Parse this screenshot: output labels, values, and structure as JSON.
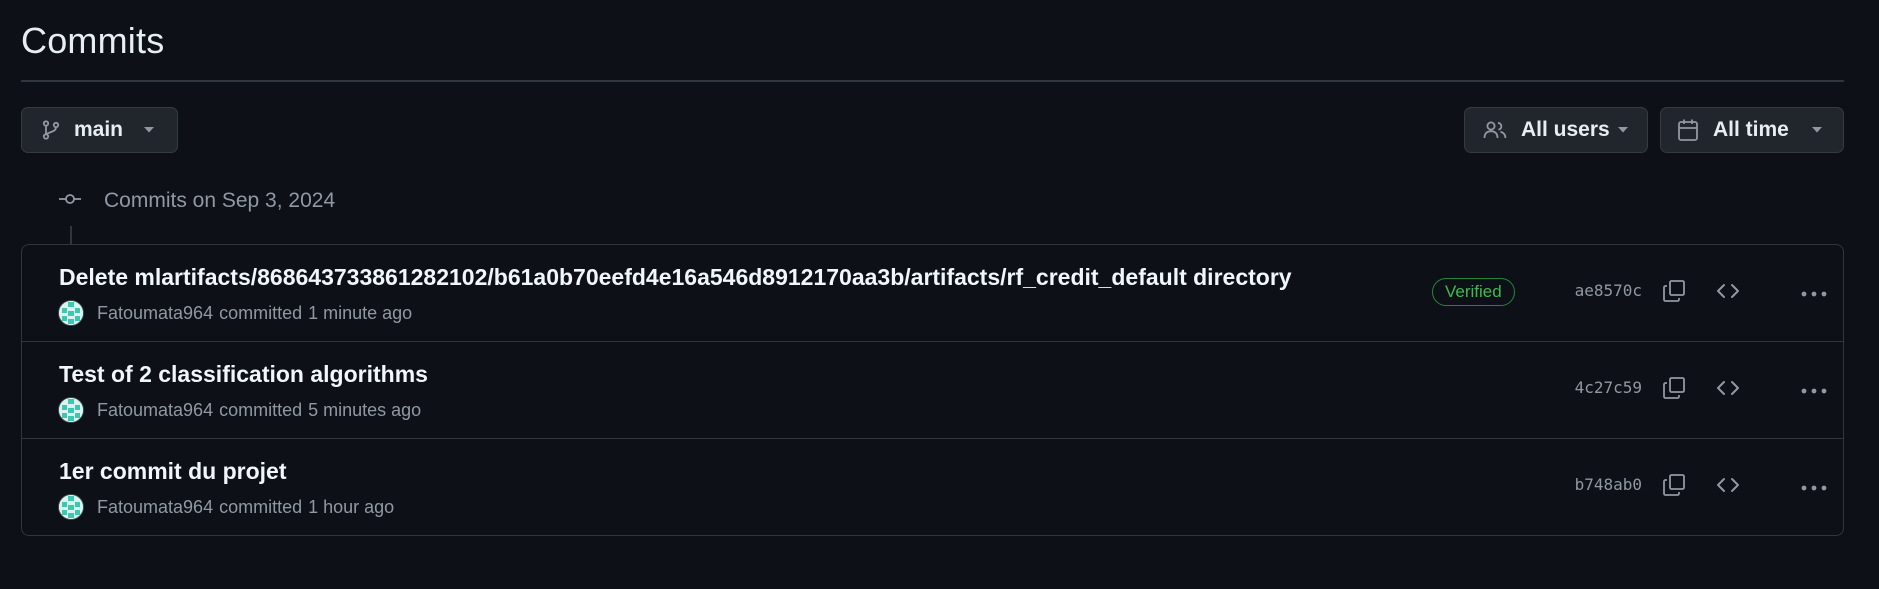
{
  "header": {
    "title": "Commits"
  },
  "filters": {
    "branch": {
      "label": "main",
      "icon": "git-branch-icon"
    },
    "users": {
      "label": "All users",
      "icon": "people-icon"
    },
    "time": {
      "label": "All time",
      "icon": "calendar-icon"
    }
  },
  "timeline": {
    "heading": "Commits on Sep 3, 2024",
    "icon": "git-commit-icon"
  },
  "commits": [
    {
      "message": "Delete mlartifacts/868643733861282102/b61a0b70eefd4e16a546d8912170aa3b/artifacts/rf_credit_default directory",
      "author": "Fatoumata964",
      "action": "committed",
      "time": "1 minute ago",
      "badge": "Verified",
      "sha": "ae8570c"
    },
    {
      "message": "Test of 2 classification algorithms",
      "author": "Fatoumata964",
      "action": "committed",
      "time": "5 minutes ago",
      "badge": "",
      "sha": "4c27c59"
    },
    {
      "message": "1er commit du projet",
      "author": "Fatoumata964",
      "action": "committed",
      "time": "1 hour ago",
      "badge": "",
      "sha": "b748ab0"
    }
  ],
  "row_icons": [
    "copy-icon",
    "code-icon",
    "kebab-horizontal-icon"
  ],
  "colors": {
    "background": "#0d1117",
    "border": "#30363d",
    "button_bg": "#21262d",
    "verified": "#3fb950",
    "muted_text": "#9198a1"
  }
}
